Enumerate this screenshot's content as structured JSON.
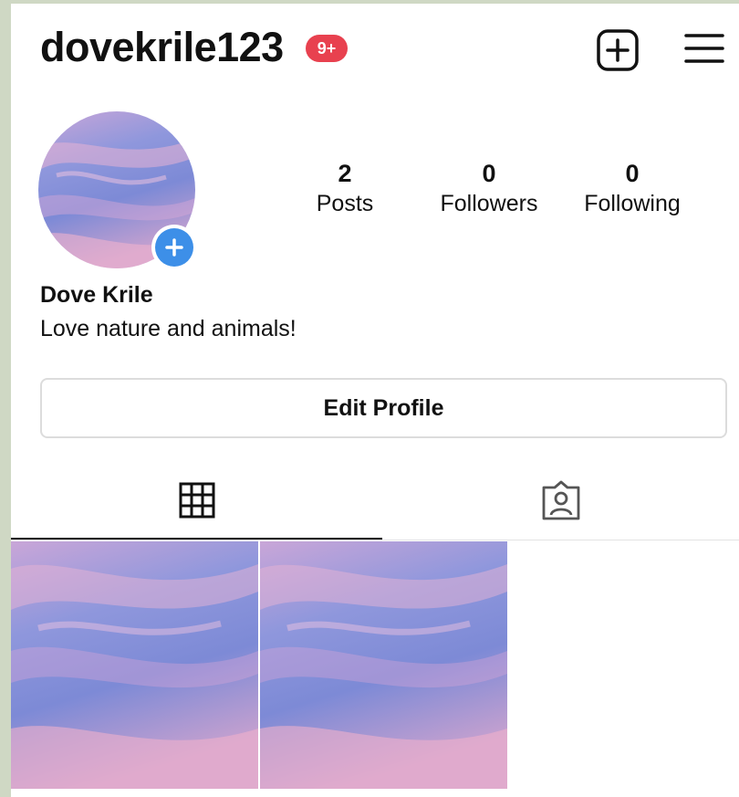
{
  "header": {
    "username": "dovekrile123",
    "notification_badge": "9+"
  },
  "profile": {
    "stats": [
      {
        "value": "2",
        "label": "Posts"
      },
      {
        "value": "0",
        "label": "Followers"
      },
      {
        "value": "0",
        "label": "Following"
      }
    ],
    "display_name": "Dove Krile",
    "bio": "Love nature and animals!",
    "edit_button_label": "Edit Profile"
  },
  "tabs": [
    {
      "icon": "grid-icon",
      "selected": true
    },
    {
      "icon": "tagged-person-icon",
      "selected": false
    }
  ],
  "posts": [
    {
      "image": "pink-purple-sky-clouds"
    },
    {
      "image": "pink-purple-sky-clouds"
    }
  ],
  "colors": {
    "badge": "#e8414f",
    "add_story": "#3d8fe8",
    "text": "#111111"
  }
}
